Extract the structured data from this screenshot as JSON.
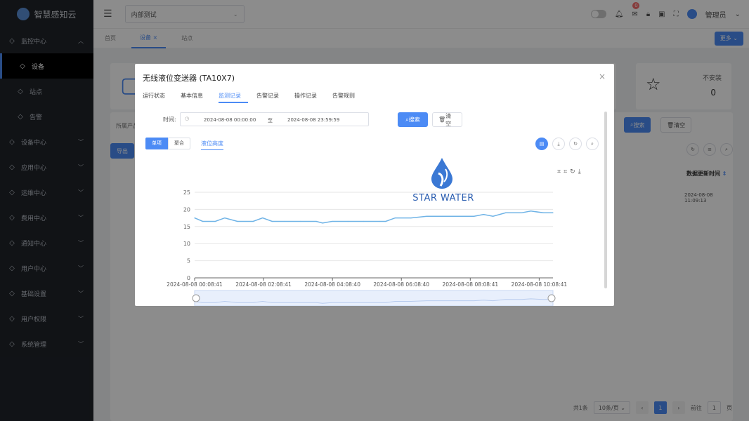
{
  "app": {
    "name": "智慧感知云"
  },
  "sidebar": {
    "items": [
      {
        "label": "监控中心",
        "icon": "monitor-icon",
        "expanded": true
      },
      {
        "label": "设备",
        "icon": "device-icon",
        "sub": true,
        "active": true
      },
      {
        "label": "站点",
        "icon": "site-icon",
        "sub": true
      },
      {
        "label": "告警",
        "icon": "alert-icon",
        "sub": true
      },
      {
        "label": "设备中心",
        "icon": "device-center-icon"
      },
      {
        "label": "应用中心",
        "icon": "app-icon"
      },
      {
        "label": "运维中心",
        "icon": "ops-icon"
      },
      {
        "label": "费用中心",
        "icon": "cost-icon"
      },
      {
        "label": "通知中心",
        "icon": "bell-icon"
      },
      {
        "label": "用户中心",
        "icon": "user-icon"
      },
      {
        "label": "基础设置",
        "icon": "settings-icon"
      },
      {
        "label": "用户权限",
        "icon": "permission-icon"
      },
      {
        "label": "系统管理",
        "icon": "gear-icon"
      }
    ]
  },
  "topbar": {
    "tenant": "内部测试",
    "notification_count": "0",
    "user": "管理员"
  },
  "tabs": [
    "首页",
    "设备",
    "站点"
  ],
  "more_label": "更多",
  "background": {
    "stat_label_1": "不安装",
    "stat_value_1": "0",
    "filter_label": "所属产品",
    "search_label": "搜索",
    "reset_label": "清空",
    "export_label": "导出",
    "column_update": "数据更新时间",
    "row_update": "2024-08-08 11:09:13",
    "pagination": {
      "total": "共1条",
      "page_size": "10条/页",
      "current": "1",
      "goto_label": "前往",
      "goto_value": "1",
      "page_suffix": "页"
    }
  },
  "dialog": {
    "title": "无线液位变送器 (TA10X7)",
    "tabs": [
      "运行状态",
      "基本信息",
      "监测记录",
      "告警记录",
      "操作记录",
      "告警规则"
    ],
    "active_tab": 2,
    "time_label": "时间:",
    "start": "2024-08-08 00:00:00",
    "separator": "至",
    "end": "2024-08-08 23:59:59",
    "search": "搜索",
    "reset": "清空",
    "view_modes": [
      "单项",
      "聚合"
    ],
    "metric": "液位高度"
  },
  "watermark": {
    "text": "STAR WATER"
  },
  "colors": {
    "accent": "#4c8bf5",
    "sidebar_bg": "#1f2329",
    "line": "#6fb3e6"
  },
  "chart_data": {
    "type": "line",
    "title": "",
    "xlabel": "",
    "ylabel": "",
    "ylim": [
      0,
      25
    ],
    "yticks": [
      0,
      5,
      10,
      15,
      20,
      25
    ],
    "xticks": [
      "2024-08-08 00:08:41",
      "2024-08-08 02:08:41",
      "2024-08-08 04:08:40",
      "2024-08-08 06:08:40",
      "2024-08-08 08:08:41",
      "2024-08-08 10:08:41"
    ],
    "xrange_hours": [
      0.145,
      11.5
    ],
    "series": [
      {
        "x": [
          0.145,
          0.4,
          0.8,
          1.1,
          1.5,
          2.0,
          2.3,
          2.6,
          3.0,
          3.5,
          4.0,
          4.2,
          4.5,
          5.0,
          5.5,
          6.0,
          6.2,
          6.5,
          7.0,
          7.5,
          8.0,
          8.5,
          9.0,
          9.3,
          9.6,
          10.0,
          10.5,
          10.8,
          11.2,
          11.5
        ],
        "values": [
          17.5,
          16.5,
          16.5,
          17.5,
          16.5,
          16.5,
          17.5,
          16.5,
          16.5,
          16.5,
          16.5,
          16.0,
          16.5,
          16.5,
          16.5,
          16.5,
          16.5,
          17.5,
          17.5,
          18.0,
          18.0,
          18.0,
          18.0,
          18.5,
          18.0,
          19.0,
          19.0,
          19.5,
          19.0,
          19.0
        ]
      }
    ]
  }
}
